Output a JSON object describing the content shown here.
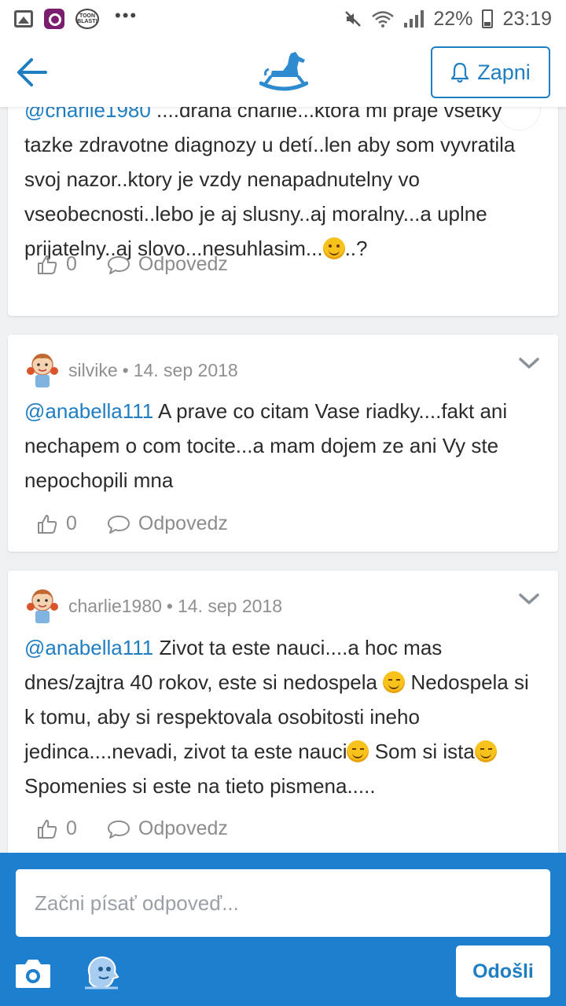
{
  "status_bar": {
    "battery": "22%",
    "time": "23:19",
    "app_icons": [
      "gallery-icon",
      "camera-app-icon",
      "toon-blast-icon"
    ],
    "toon_label_1": "TOON",
    "toon_label_2": "BLAST!",
    "more": "•••"
  },
  "appbar": {
    "notify_label": "Zapni",
    "accent": "#1f7ec2"
  },
  "comments": [
    {
      "author": "",
      "date": "",
      "segments": [
        {
          "type": "mention",
          "text": "@charlie1980"
        },
        {
          "type": "text",
          "text": " ....drahá charlie...ktora mi praje vsetky tazke zdravotne diagnozy u detí..len aby som vyvratila svoj nazor..ktory je vzdy nenapadnutelny vo vseobecnosti..lebo je aj slusny..aj moralny...a uplne prijatelny..aj slovo...nesuhlasim..."
        },
        {
          "type": "emoji",
          "name": "blush"
        },
        {
          "type": "text",
          "text": "..?"
        }
      ],
      "likes": "0",
      "reply_label": "Odpovedz"
    },
    {
      "author": "silvike",
      "date": "14. sep 2018",
      "segments": [
        {
          "type": "mention",
          "text": "@anabella111"
        },
        {
          "type": "text",
          "text": " A prave co citam Vase riadky....fakt ani nechapem o com tocite...a mam dojem ze ani Vy ste nepochopili mna"
        }
      ],
      "likes": "0",
      "reply_label": "Odpovedz"
    },
    {
      "author": "charlie1980",
      "date": "14. sep 2018",
      "segments": [
        {
          "type": "mention",
          "text": "@anabella111"
        },
        {
          "type": "text",
          "text": " Zivot ta este nauci....a hoc mas dnes/zajtra 40 rokov, este si nedospela "
        },
        {
          "type": "emoji",
          "name": "wink"
        },
        {
          "type": "text",
          "text": " Nedospela si k tomu, aby si respektovala osobitosti ineho jedinca....nevadi, zivot ta este nauci"
        },
        {
          "type": "emoji",
          "name": "wink"
        },
        {
          "type": "text",
          "text": " Som si ista"
        },
        {
          "type": "emoji",
          "name": "wink"
        },
        {
          "type": "text",
          "text": " Spomenies si este na tieto pismena....."
        }
      ],
      "likes": "0",
      "reply_label": "Odpovedz"
    }
  ],
  "composer": {
    "placeholder": "Začni písať odpoveď...",
    "send_label": "Odošli",
    "background": "#1f7fcf"
  }
}
